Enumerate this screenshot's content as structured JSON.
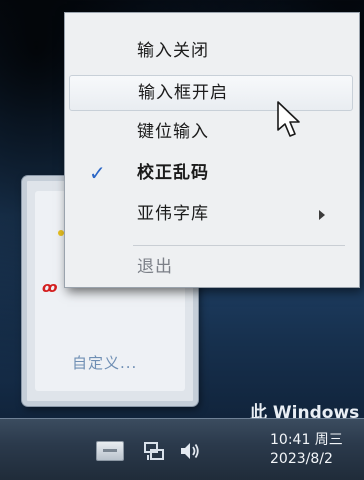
{
  "context_menu": {
    "items": [
      {
        "label": "输入关闭",
        "checked": false,
        "disabled": false,
        "bold": false,
        "hovered": false,
        "has_submenu": false
      },
      {
        "label": "输入框开启",
        "checked": false,
        "disabled": false,
        "bold": false,
        "hovered": true,
        "has_submenu": false
      },
      {
        "label": "键位输入",
        "checked": false,
        "disabled": false,
        "bold": false,
        "hovered": false,
        "has_submenu": false
      },
      {
        "label": "校正乱码",
        "checked": true,
        "disabled": false,
        "bold": true,
        "hovered": false,
        "has_submenu": false
      },
      {
        "label": "亚伟字库",
        "checked": false,
        "disabled": false,
        "bold": false,
        "hovered": false,
        "has_submenu": true
      },
      {
        "label": "退出",
        "checked": false,
        "disabled": true,
        "bold": false,
        "hovered": false,
        "has_submenu": false
      }
    ],
    "check_glyph": "✓",
    "check_color": "#2a66c6"
  },
  "background_window": {
    "customize_label": "自定义..."
  },
  "desktop": {
    "watermark_text": "此 Windows"
  },
  "taskbar": {
    "tray_icons": [
      "keyboard-icon",
      "network-icon",
      "volume-icon"
    ],
    "clock_time": "10:41 周三",
    "clock_date": "2023/8/2"
  }
}
